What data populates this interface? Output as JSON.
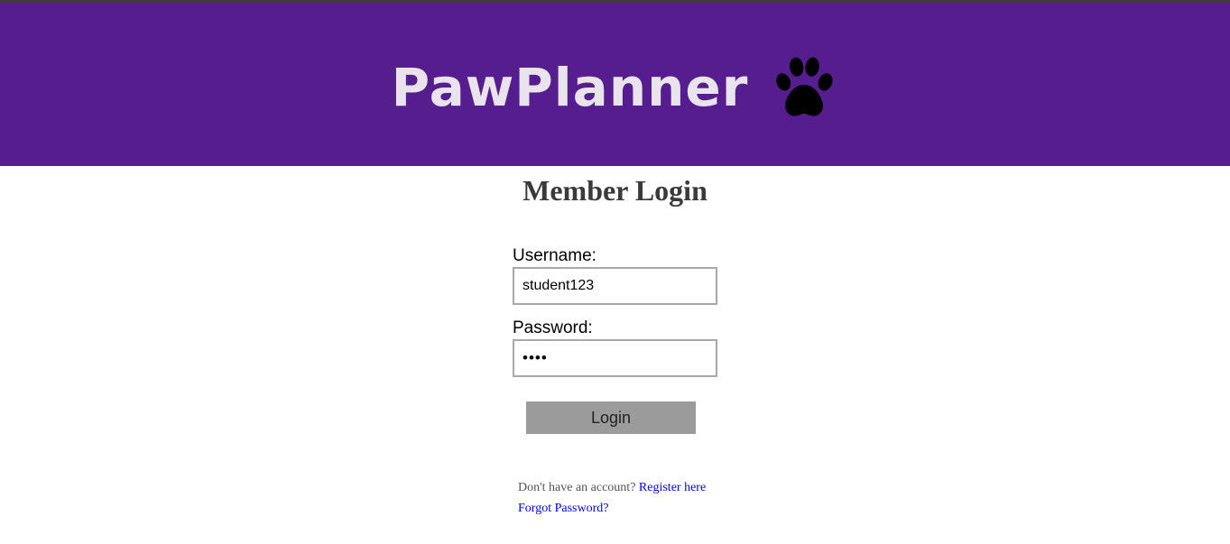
{
  "header": {
    "title": "PawPlanner",
    "icon": "paw-icon"
  },
  "login": {
    "heading": "Member Login",
    "username_label": "Username:",
    "username_value": "student123",
    "password_label": "Password:",
    "password_value": "••••",
    "submit_label": "Login"
  },
  "footer": {
    "account_prompt": "Don't have an account?",
    "register_link": "Register here",
    "forgot_link": "Forgot Password?"
  },
  "colors": {
    "banner": "#561d8e",
    "title_text": "#e8e3ec",
    "button_bg": "#9b9b9b",
    "link": "#0000ee"
  }
}
